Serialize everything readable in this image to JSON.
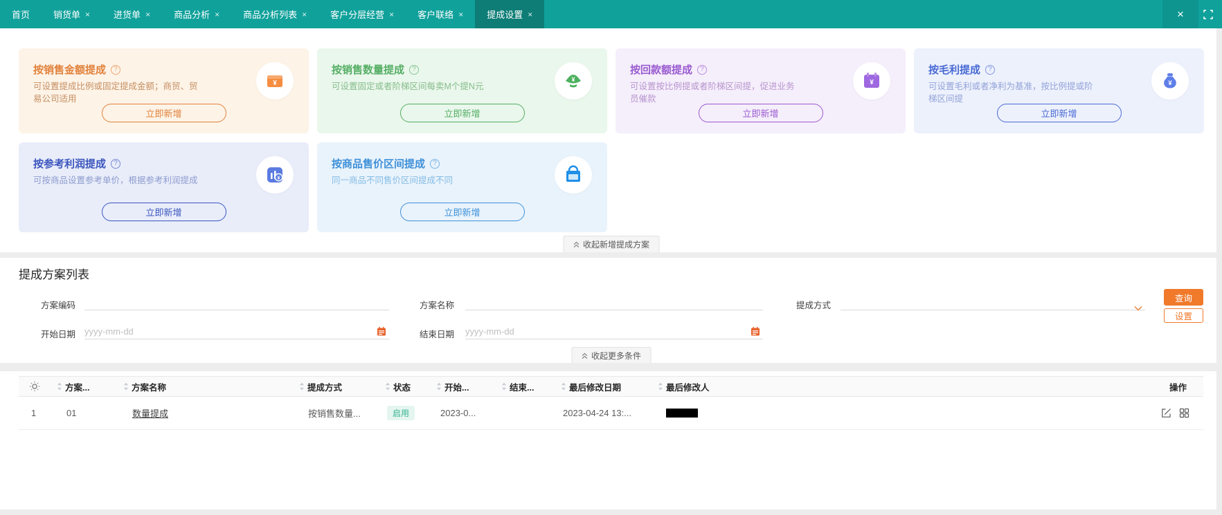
{
  "nav": {
    "close_glyph": "×",
    "tabs": [
      {
        "label": "首页",
        "closable": false,
        "active": false
      },
      {
        "label": "销货单",
        "closable": true,
        "active": false
      },
      {
        "label": "进货单",
        "closable": true,
        "active": false
      },
      {
        "label": "商品分析",
        "closable": true,
        "active": false
      },
      {
        "label": "商品分析列表",
        "closable": true,
        "active": false
      },
      {
        "label": "客户分层经营",
        "closable": true,
        "active": false
      },
      {
        "label": "客户联络",
        "closable": true,
        "active": false
      },
      {
        "label": "提成设置",
        "closable": true,
        "active": true
      }
    ]
  },
  "cards_section": {
    "help_glyph": "?",
    "collapse_label": "收起新增提成方案",
    "items": [
      {
        "title": "按销售金额提成",
        "desc": "可设置提成比例或固定提成金额；商贸、贸易公司适用",
        "button": "立即新增",
        "icon": "cashbox-icon",
        "accent": "#e2813a",
        "bg": "#fdf3e7"
      },
      {
        "title": "按销售数量提成",
        "desc": "可设置固定或者阶梯区间每卖M个提N元",
        "button": "立即新增",
        "icon": "gold-ingot-icon",
        "accent": "#54ae64",
        "bg": "#eaf7ec"
      },
      {
        "title": "按回款额提成",
        "desc": "可设置按比例提或者阶梯区间提，促进业务员催款",
        "button": "立即新增",
        "icon": "calendar-money-icon",
        "accent": "#9a5bd0",
        "bg": "#f5eefb"
      },
      {
        "title": "按毛利提成",
        "desc": "可设置毛利或者净利为基准，按比例提或阶梯区间提",
        "button": "立即新增",
        "icon": "money-bag-icon",
        "accent": "#4a6ad4",
        "bg": "#edf1fc"
      },
      {
        "title": "按参考利润提成",
        "desc": "可按商品设置参考单价，根据参考利润提成",
        "button": "立即新增",
        "icon": "bar-chart-money-icon",
        "accent": "#3a55bd",
        "bg": "#e9edfa"
      },
      {
        "title": "按商品售价区间提成",
        "desc": "同一商品不同售价区间提成不同",
        "button": "立即新增",
        "icon": "shopping-bag-icon",
        "accent": "#3e90d8",
        "bg": "#e9f3fc"
      }
    ]
  },
  "list_section": {
    "title": "提成方案列表",
    "filters": {
      "code_label": "方案编码",
      "name_label": "方案名称",
      "method_label": "提成方式",
      "start_label": "开始日期",
      "end_label": "结束日期",
      "date_placeholder": "yyyy-mm-dd",
      "search_button": "查询",
      "settings_button": "设置",
      "collapse_label": "收起更多条件"
    },
    "table": {
      "columns": {
        "code": "方案...",
        "name": "方案名称",
        "method": "提成方式",
        "status": "状态",
        "start": "开始...",
        "end": "结束...",
        "modified_date": "最后修改日期",
        "modified_by": "最后修改人",
        "action": "操作"
      },
      "rows": [
        {
          "index": "1",
          "code": "01",
          "name": "数量提成",
          "method": "按销售数量...",
          "status": "启用",
          "start_date": "2023-0...",
          "end_date": "",
          "modified_date": "2023-04-24 13:...",
          "modified_by_redacted": true
        }
      ]
    }
  },
  "colors": {
    "nav_bg": "#10a19b",
    "nav_active_bg": "#0d7d76",
    "primary_orange": "#f0792a",
    "status_enabled_bg": "#e4f6ef",
    "status_enabled_text": "#36b392"
  }
}
